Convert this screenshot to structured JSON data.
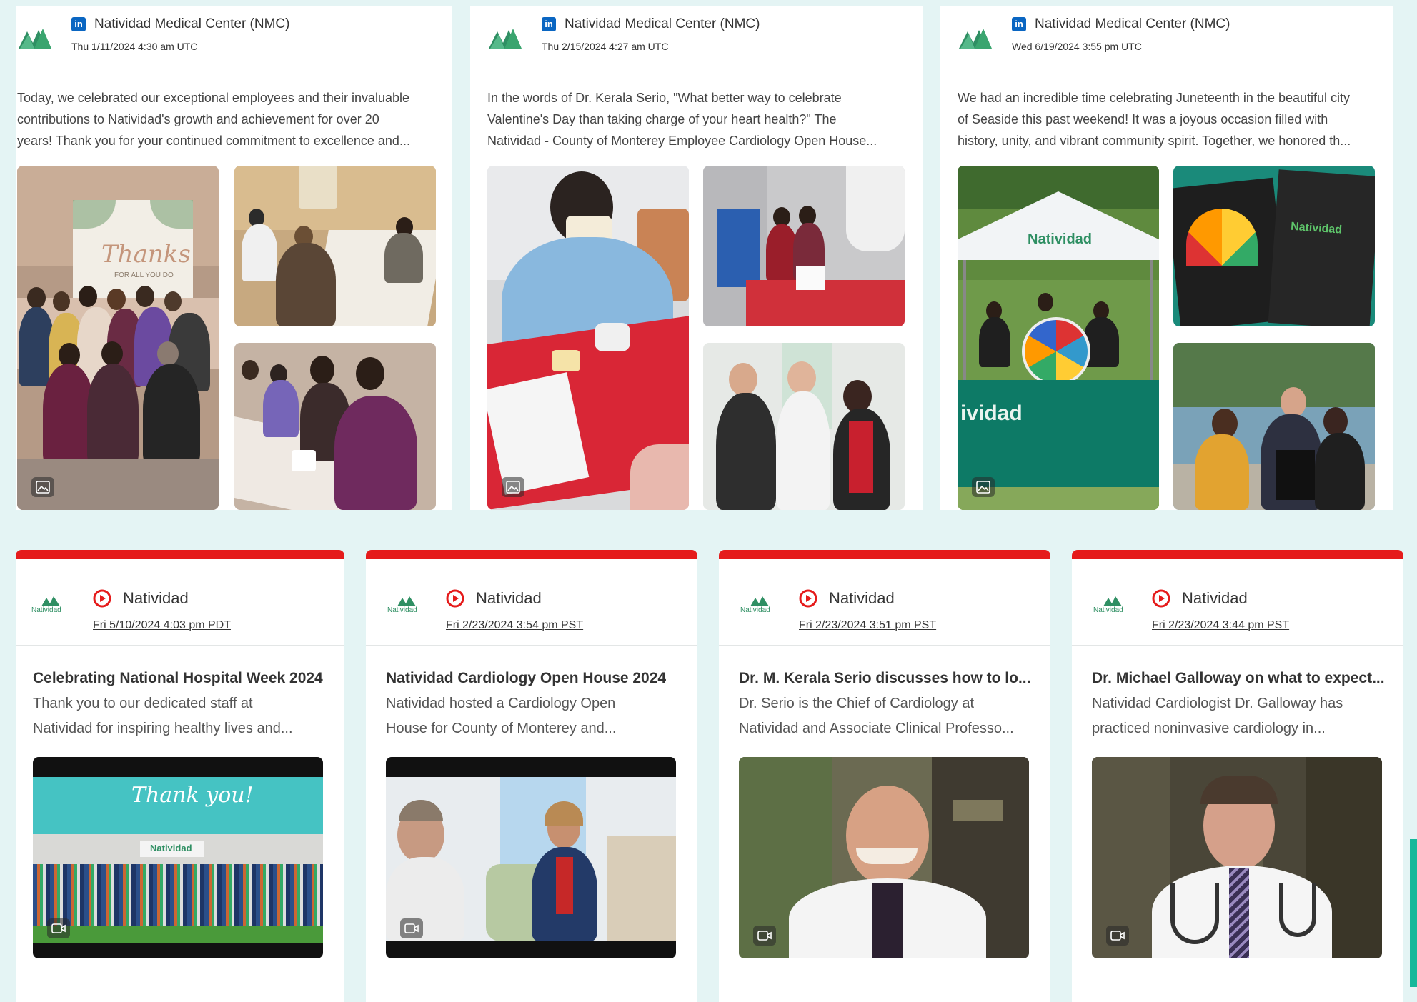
{
  "linkedin_posts": [
    {
      "source": "Natividad Medical Center (NMC)",
      "date": "Thu 1/11/2024 4:30 am UTC",
      "text": [
        "Today, we celebrated our exceptional employees and their invaluable",
        "contributions to Natividad's growth and achievement for over 20",
        "years! Thank you for your continued commitment to excellence and..."
      ],
      "banner_text": "Thanks",
      "banner_subtext": "FOR ALL YOU DO"
    },
    {
      "source": "Natividad Medical Center (NMC)",
      "date": "Thu 2/15/2024 4:27 am UTC",
      "text": [
        "In the words of Dr. Kerala Serio, \"What better way to celebrate",
        "Valentine's Day than taking charge of your heart health?\" The",
        "Natividad - County of Monterey Employee Cardiology Open House..."
      ]
    },
    {
      "source": "Natividad Medical Center (NMC)",
      "date": "Wed 6/19/2024 3:55 pm UTC",
      "text": [
        "We had an incredible time celebrating Juneteenth in the beautiful city",
        "of Seaside this past weekend! It was a joyous occasion filled with",
        "history, unity, and vibrant community spirit. Together, we honored th..."
      ],
      "tent_text": "Natividad",
      "tablecloth_text": "ividad",
      "bag_text": "Natividad"
    }
  ],
  "youtube_posts": [
    {
      "source": "Natividad",
      "date": "Fri 5/10/2024 4:03 pm PDT",
      "title": "Celebrating National Hospital Week 2024",
      "desc": [
        "Thank you to our dedicated staff at",
        "Natividad for inspiring healthy lives and..."
      ],
      "thumb_text": "Thank you!",
      "sign_text": "Natividad"
    },
    {
      "source": "Natividad",
      "date": "Fri 2/23/2024 3:54 pm PST",
      "title": "Natividad Cardiology Open House 2024",
      "desc": [
        "Natividad hosted a Cardiology Open",
        "House for County of Monterey and..."
      ]
    },
    {
      "source": "Natividad",
      "date": "Fri 2/23/2024 3:51 pm PST",
      "title": "Dr. M. Kerala Serio discusses how to lo...",
      "desc": [
        "Dr. Serio is the Chief of Cardiology at",
        "Natividad and Associate Clinical Professo..."
      ]
    },
    {
      "source": "Natividad",
      "date": "Fri 2/23/2024 3:44 pm PST",
      "title": "Dr. Michael Galloway on what to expect...",
      "desc": [
        "Natividad Cardiologist Dr. Galloway has",
        "practiced noninvasive cardiology in..."
      ]
    }
  ],
  "logo_caption": "Natividad",
  "linkedin_badge": "in",
  "icons": {
    "linkedin": "linkedin-icon",
    "youtube": "youtube-icon",
    "photo": "image-icon",
    "video": "video-icon"
  },
  "colors": {
    "page_bg": "#e4f4f4",
    "brand_green": "#2f8f63",
    "linkedin_blue": "#0a66c2",
    "youtube_red": "#e51b1b"
  }
}
